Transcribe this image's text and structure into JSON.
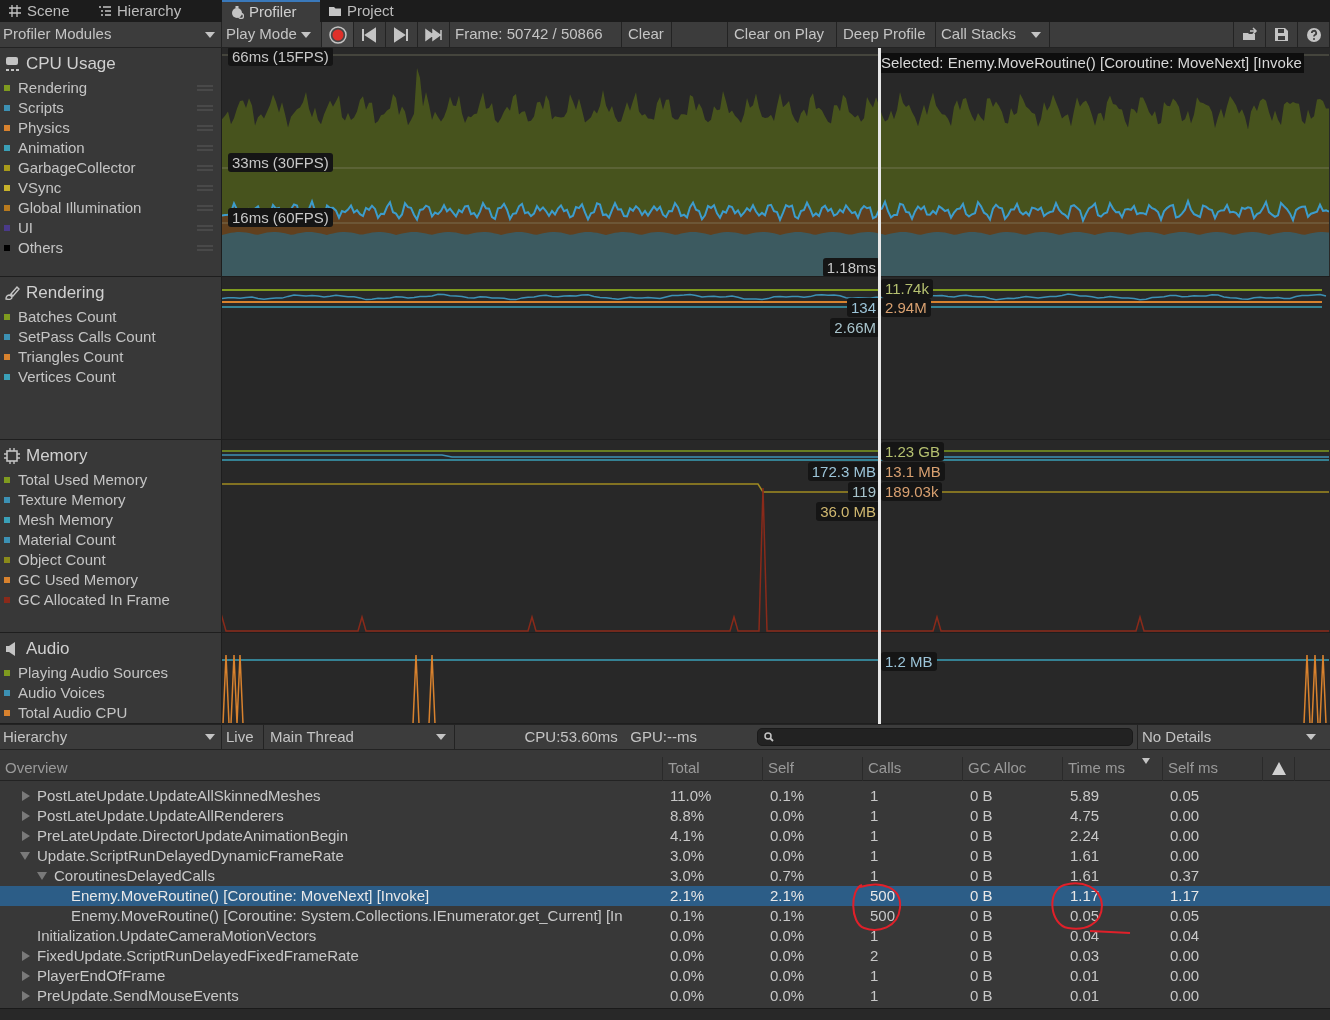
{
  "editor_tabs": [
    {
      "label": "Scene",
      "selected": false
    },
    {
      "label": "Hierarchy",
      "selected": false
    },
    {
      "label": "Profiler",
      "selected": true
    },
    {
      "label": "Project",
      "selected": false
    }
  ],
  "toolbar": {
    "modules_dropdown": "Profiler Modules",
    "play_mode": "Play Mode",
    "recording": true,
    "frame": "Frame: 50742 / 50866",
    "clear": "Clear",
    "clear_on_play": "Clear on Play",
    "deep_profile": "Deep Profile",
    "call_stacks": "Call Stacks"
  },
  "modules": [
    {
      "title": "CPU Usage",
      "kind": "cpu",
      "selected_label": "Selected: Enemy.MoveRoutine() [Coroutine: MoveNext] [Invoke",
      "items": [
        {
          "label": "Rendering",
          "color": "#7f9b1f"
        },
        {
          "label": "Scripts",
          "color": "#3c91b4"
        },
        {
          "label": "Physics",
          "color": "#d8822e"
        },
        {
          "label": "Animation",
          "color": "#3aa0b8"
        },
        {
          "label": "GarbageCollector",
          "color": "#a89a1a"
        },
        {
          "label": "VSync",
          "color": "#c8b22a"
        },
        {
          "label": "Global Illumination",
          "color": "#b87a1e"
        },
        {
          "label": "UI",
          "color": "#4a3a8a"
        },
        {
          "label": "Others",
          "color": "#000000"
        }
      ],
      "chart_labels": [
        {
          "text": "66ms (15FPS)"
        },
        {
          "text": "33ms (30FPS)"
        },
        {
          "text": "16ms (60FPS)"
        },
        {
          "text": "1.18ms"
        }
      ]
    },
    {
      "title": "Rendering",
      "kind": "rendering",
      "items": [
        {
          "label": "Batches Count",
          "color": "#7f9b1f"
        },
        {
          "label": "SetPass Calls Count",
          "color": "#3c91b4"
        },
        {
          "label": "Triangles Count",
          "color": "#d8822e"
        },
        {
          "label": "Vertices Count",
          "color": "#3aa0b8"
        }
      ],
      "chart_labels": [
        {
          "text": "11.74k",
          "color": "#b5c070"
        },
        {
          "text": "134",
          "color": "#9cc4d8"
        },
        {
          "text": "2.94M",
          "color": "#d8a070"
        },
        {
          "text": "2.66M",
          "color": "#a8c4cc"
        }
      ]
    },
    {
      "title": "Memory",
      "kind": "memory",
      "items": [
        {
          "label": "Total Used Memory",
          "color": "#7f9b1f"
        },
        {
          "label": "Texture Memory",
          "color": "#3c91b4"
        },
        {
          "label": "Mesh Memory",
          "color": "#3aa0b8"
        },
        {
          "label": "Material Count",
          "color": "#3c91b4"
        },
        {
          "label": "Object Count",
          "color": "#8a8a1a"
        },
        {
          "label": "GC Used Memory",
          "color": "#d8822e"
        },
        {
          "label": "GC Allocated In Frame",
          "color": "#8a2a1a"
        }
      ],
      "chart_labels": [
        {
          "text": "1.23 GB",
          "color": "#b5c070"
        },
        {
          "text": "172.3 MB",
          "color": "#9cc4d8"
        },
        {
          "text": "13.1 MB",
          "color": "#d8a070"
        },
        {
          "text": "119",
          "color": "#a8c4cc"
        },
        {
          "text": "189.03k",
          "color": "#d8a070"
        },
        {
          "text": "36.0 MB",
          "color": "#d0b870"
        }
      ]
    },
    {
      "title": "Audio",
      "kind": "audio",
      "items": [
        {
          "label": "Playing Audio Sources",
          "color": "#7f9b1f"
        },
        {
          "label": "Audio Voices",
          "color": "#3c91b4"
        },
        {
          "label": "Total Audio CPU",
          "color": "#d8822e"
        }
      ],
      "chart_labels": [
        {
          "text": "1.2 MB",
          "color": "#9cc4d8"
        }
      ]
    }
  ],
  "details_toolbar": {
    "view": "Hierarchy",
    "live": "Live",
    "thread": "Main Thread",
    "timing": "CPU:53.60ms   GPU:--ms",
    "details": "No Details"
  },
  "table": {
    "columns": [
      {
        "label": "Overview",
        "sorted": false
      },
      {
        "label": "Total",
        "sorted": false
      },
      {
        "label": "Self",
        "sorted": false
      },
      {
        "label": "Calls",
        "sorted": false
      },
      {
        "label": "GC Alloc",
        "sorted": false
      },
      {
        "label": "Time ms",
        "sorted": true
      },
      {
        "label": "Self ms",
        "sorted": false
      }
    ],
    "rows": [
      {
        "name": "PostLateUpdate.UpdateAllSkinnedMeshes",
        "kind": "group",
        "expanded": false,
        "selected": false,
        "values": [
          "11.0%",
          "0.1%",
          "1",
          "0 B",
          "5.89",
          "0.05"
        ]
      },
      {
        "name": "PostLateUpdate.UpdateAllRenderers",
        "kind": "group",
        "expanded": false,
        "selected": false,
        "values": [
          "8.8%",
          "0.0%",
          "1",
          "0 B",
          "4.75",
          "0.00"
        ]
      },
      {
        "name": "PreLateUpdate.DirectorUpdateAnimationBegin",
        "kind": "group",
        "expanded": false,
        "selected": false,
        "values": [
          "4.1%",
          "0.0%",
          "1",
          "0 B",
          "2.24",
          "0.00"
        ]
      },
      {
        "name": "Update.ScriptRunDelayedDynamicFrameRate",
        "kind": "group",
        "expanded": true,
        "selected": false,
        "values": [
          "3.0%",
          "0.0%",
          "1",
          "0 B",
          "1.61",
          "0.00"
        ],
        "children": [
          {
            "name": "CoroutinesDelayedCalls",
            "kind": "group",
            "expanded": true,
            "selected": false,
            "values": [
              "3.0%",
              "0.7%",
              "1",
              "0 B",
              "1.61",
              "0.37"
            ],
            "children": [
              {
                "name": "Enemy.MoveRoutine() [Coroutine: MoveNext] [Invoke]",
                "kind": "leaf",
                "selected": true,
                "values": [
                  "2.1%",
                  "2.1%",
                  "500",
                  "0 B",
                  "1.17",
                  "1.17"
                ]
              },
              {
                "name": "Enemy.MoveRoutine() [Coroutine: System.Collections.IEnumerator.get_Current] [In",
                "kind": "leaf",
                "selected": false,
                "values": [
                  "0.1%",
                  "0.1%",
                  "500",
                  "0 B",
                  "0.05",
                  "0.05"
                ]
              }
            ]
          }
        ]
      },
      {
        "name": "Initialization.UpdateCameraMotionVectors",
        "kind": "leaf",
        "selected": false,
        "values": [
          "0.0%",
          "0.0%",
          "1",
          "0 B",
          "0.04",
          "0.04"
        ]
      },
      {
        "name": "FixedUpdate.ScriptRunDelayedFixedFrameRate",
        "kind": "group",
        "expanded": false,
        "selected": false,
        "values": [
          "0.0%",
          "0.0%",
          "2",
          "0 B",
          "0.03",
          "0.00"
        ]
      },
      {
        "name": "PlayerEndOfFrame",
        "kind": "group",
        "expanded": false,
        "selected": false,
        "values": [
          "0.0%",
          "0.0%",
          "1",
          "0 B",
          "0.01",
          "0.00"
        ]
      },
      {
        "name": "PreUpdate.SendMouseEvents",
        "kind": "group",
        "expanded": false,
        "selected": false,
        "values": [
          "0.0%",
          "0.0%",
          "1",
          "0 B",
          "0.01",
          "0.00"
        ]
      }
    ]
  }
}
